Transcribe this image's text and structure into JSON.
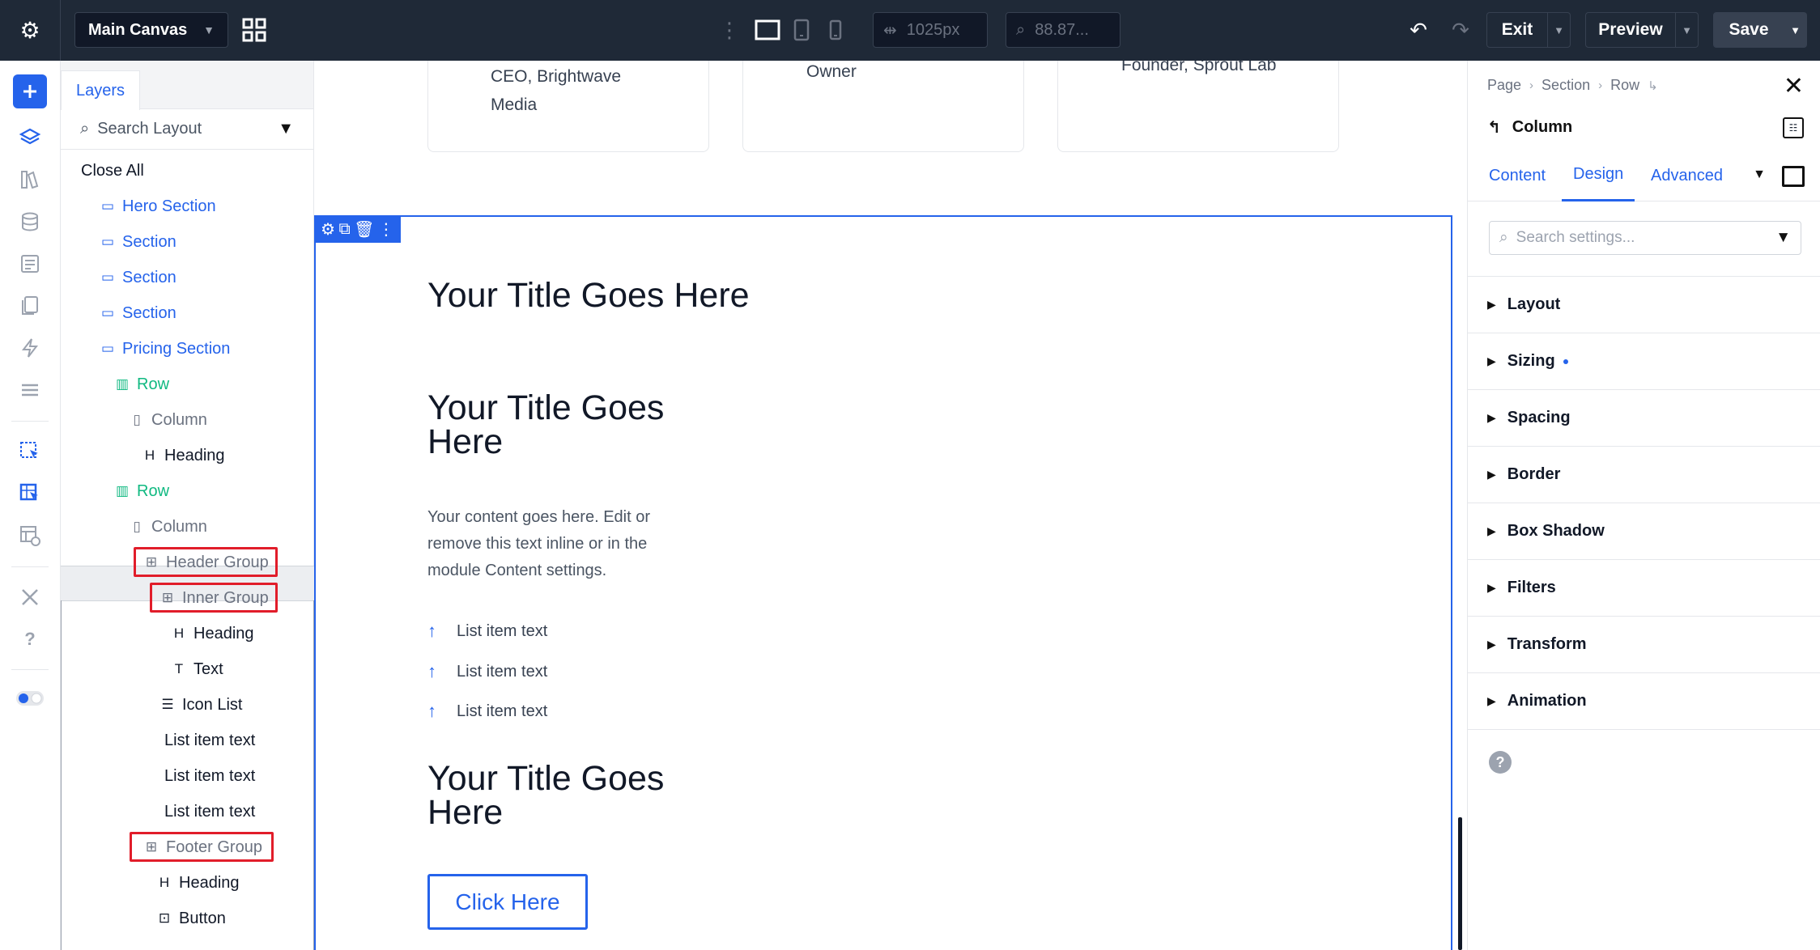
{
  "topbar": {
    "canvas_name": "Main Canvas",
    "width_value": "1025px",
    "zoom_value": "88.87...",
    "exit_label": "Exit",
    "preview_label": "Preview",
    "save_label": "Save"
  },
  "layers": {
    "tab_label": "Layers",
    "search_placeholder": "Search Layout",
    "close_all": "Close All",
    "items": [
      {
        "label": "Hero Section",
        "type": "section"
      },
      {
        "label": "Section",
        "type": "section"
      },
      {
        "label": "Section",
        "type": "section"
      },
      {
        "label": "Section",
        "type": "section"
      },
      {
        "label": "Pricing Section",
        "type": "section"
      },
      {
        "label": "Row",
        "type": "row"
      },
      {
        "label": "Column",
        "type": "column"
      },
      {
        "label": "Heading",
        "type": "heading"
      },
      {
        "label": "Row",
        "type": "row"
      },
      {
        "label": "Column",
        "type": "column"
      },
      {
        "label": "Header Group",
        "type": "group"
      },
      {
        "label": "Inner Group",
        "type": "group"
      },
      {
        "label": "Heading",
        "type": "heading"
      },
      {
        "label": "Text",
        "type": "text"
      },
      {
        "label": "Icon List",
        "type": "iconlist"
      },
      {
        "label": "List item text",
        "type": "listitem"
      },
      {
        "label": "List item text",
        "type": "listitem"
      },
      {
        "label": "List item text",
        "type": "listitem"
      },
      {
        "label": "Footer Group",
        "type": "group"
      },
      {
        "label": "Heading",
        "type": "heading"
      },
      {
        "label": "Button",
        "type": "button"
      }
    ]
  },
  "canvas": {
    "testimonials": [
      {
        "line1": "CEO, Brightwave",
        "line2": "Media"
      },
      {
        "line1": "Owner",
        "line2": ""
      },
      {
        "line1": "Founder, Sprout Lab",
        "line2": ""
      }
    ],
    "title1": "Your Title Goes Here",
    "title2": "Your Title Goes Here",
    "body_text": "Your content goes here. Edit or remove this text inline or in the module Content settings.",
    "list_items": [
      "List item text",
      "List item text",
      "List item text"
    ],
    "title3": "Your Title Goes Here",
    "button_label": "Click Here"
  },
  "settings": {
    "breadcrumb": [
      "Page",
      "Section",
      "Row"
    ],
    "element_title": "Column",
    "tabs": [
      "Content",
      "Design",
      "Advanced"
    ],
    "active_tab": "Design",
    "search_placeholder": "Search settings...",
    "groups": [
      "Layout",
      "Sizing",
      "Spacing",
      "Border",
      "Box Shadow",
      "Filters",
      "Transform",
      "Animation"
    ]
  },
  "colors": {
    "accent": "#2563eb",
    "row_green": "#10b981",
    "topbar_bg": "#1f2937",
    "highlight_red": "#e11d2a"
  }
}
